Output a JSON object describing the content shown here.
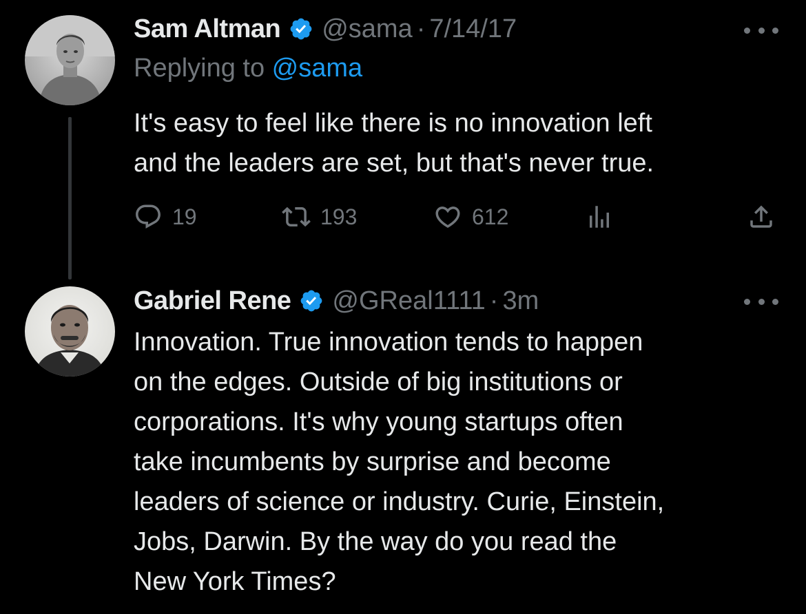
{
  "tweets": [
    {
      "author": {
        "name": "Sam Altman",
        "handle": "@sama",
        "verified": true,
        "avatar": "avatar-photo"
      },
      "separator": "·",
      "timestamp": "7/14/17",
      "replying_prefix": "Replying to ",
      "replying_to": "@sama",
      "text": "It's easy to feel like there is no innovation left\nand the leaders are set, but that's never true.",
      "stats": {
        "replies": "19",
        "retweets": "193",
        "likes": "612"
      },
      "icons": {
        "reply": "reply-icon",
        "retweet": "retweet-icon",
        "like": "heart-icon",
        "views": "views-icon",
        "share": "share-icon",
        "more": "more-icon"
      }
    },
    {
      "author": {
        "name": "Gabriel Rene",
        "handle": "@GReal1111",
        "verified": true,
        "avatar": "avatar-photo"
      },
      "separator": "·",
      "timestamp": "3m",
      "text": "Innovation. True innovation tends to happen\non the edges. Outside of big institutions or\ncorporations. It's why young startups often\ntake incumbents by surprise and become\nleaders of science or industry. Curie, Einstein,\nJobs, Darwin. By the way do you read the\nNew York Times?",
      "icons": {
        "more": "more-icon"
      }
    }
  ],
  "colors": {
    "background": "#000000",
    "primary_text": "#e7e9ea",
    "secondary_text": "#71767b",
    "accent": "#1d9bf0",
    "thread_line": "#333639"
  }
}
